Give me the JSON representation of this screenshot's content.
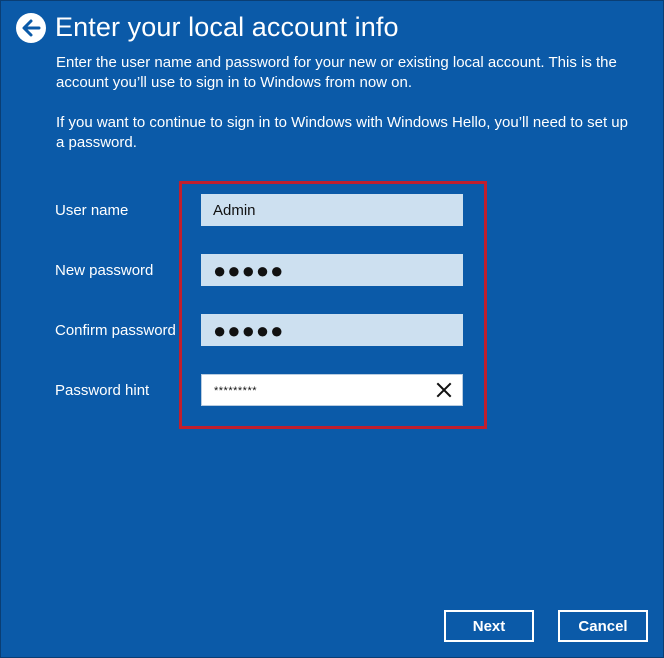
{
  "header": {
    "title": "Enter your local account info",
    "back_icon": "back-arrow-icon"
  },
  "description": {
    "paragraph_1": "Enter the user name and password for your new or existing local account. This is the account you’ll use to sign in to Windows from now on.",
    "paragraph_2": "If you want to continue to sign in to Windows with Windows Hello, you’ll need to set up a password."
  },
  "form": {
    "username": {
      "label": "User name",
      "value": "Admin"
    },
    "new_password": {
      "label": "New password",
      "value": "●●●●●"
    },
    "confirm_password": {
      "label": "Confirm password",
      "value": "●●●●●"
    },
    "password_hint": {
      "label": "Password hint",
      "value": "*********",
      "clear_icon": "close-icon"
    }
  },
  "buttons": {
    "next": "Next",
    "cancel": "Cancel"
  },
  "colors": {
    "background": "#0b5aa8",
    "field_background": "#cde0f0",
    "active_field_background": "#ffffff",
    "highlight": "#c01f2e",
    "text": "#ffffff"
  }
}
